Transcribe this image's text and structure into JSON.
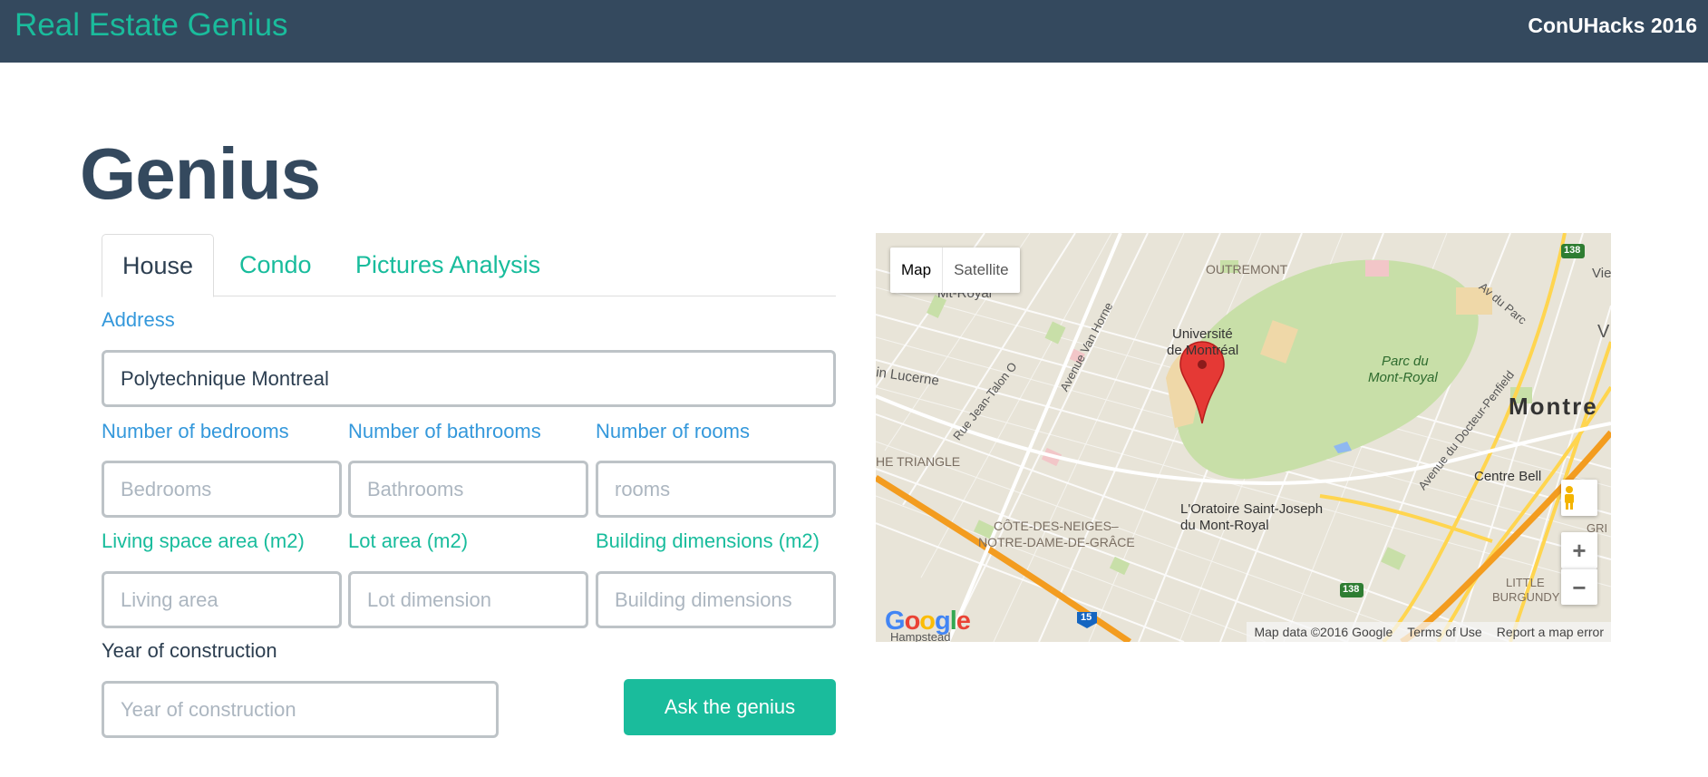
{
  "navbar": {
    "brand": "Real Estate Genius",
    "right_text": "ConUHacks 2016"
  },
  "page": {
    "title": "Genius"
  },
  "tabs": [
    {
      "label": "House",
      "active": true
    },
    {
      "label": "Condo",
      "active": false
    },
    {
      "label": "Pictures Analysis",
      "active": false
    }
  ],
  "form": {
    "address": {
      "label": "Address",
      "value": "Polytechnique Montreal"
    },
    "bedrooms": {
      "label": "Number of bedrooms",
      "placeholder": "Bedrooms"
    },
    "bathrooms": {
      "label": "Number of bathrooms",
      "placeholder": "Bathrooms"
    },
    "rooms": {
      "label": "Number of rooms",
      "placeholder": "rooms"
    },
    "living": {
      "label": "Living space area (m2)",
      "placeholder": "Living area"
    },
    "lot": {
      "label": "Lot area (m2)",
      "placeholder": "Lot dimension"
    },
    "building": {
      "label": "Building dimensions (m2)",
      "placeholder": "Building dimensions"
    },
    "year": {
      "label": "Year of construction",
      "placeholder": "Year of construction"
    },
    "submit_label": "Ask the genius"
  },
  "map": {
    "type_map": "Map",
    "type_satellite": "Satellite",
    "zoom_in": "+",
    "zoom_out": "−",
    "labels": {
      "outremont": "OUTREMONT",
      "mont_royal": "Mt-Royal",
      "universite": "Université",
      "universite2": "de Montréal",
      "parc": "Parc du",
      "parc2": "Mont-Royal",
      "lucerne": "in Lucerne",
      "jean_talon": "Rue Jean-Talon O",
      "van_horne": "Avenue Van Horne",
      "av_du_parc": "Av du Parc",
      "docteur": "Avenue du Docteur-Penfield",
      "montreal": "Montre",
      "triangle": "HE TRIANGLE",
      "centre_bell": "Centre Bell",
      "cote": "CÔTE-DES-NEIGES–",
      "notre_dame": "NOTRE-DAME-DE-GRÂCE",
      "oratoire": "L'Oratoire Saint-Joseph",
      "oratoire2": "du Mont-Royal",
      "little": "LITTLE",
      "burgundy": "BURGUNDY",
      "vie": "Vie",
      "v": "V",
      "gri": "GRI",
      "hampstead": "Hampstead",
      "r138a": "138",
      "r138b": "138",
      "r15": "15"
    },
    "google": "Google",
    "footer": {
      "data": "Map data ©2016 Google",
      "terms": "Terms of Use",
      "report": "Report a map error"
    },
    "colors": {
      "base": "#e8e4d8",
      "park": "#c8dfa8",
      "highway": "#f39c1f",
      "arterial": "#ffd54f",
      "pin": "#e53935"
    }
  }
}
